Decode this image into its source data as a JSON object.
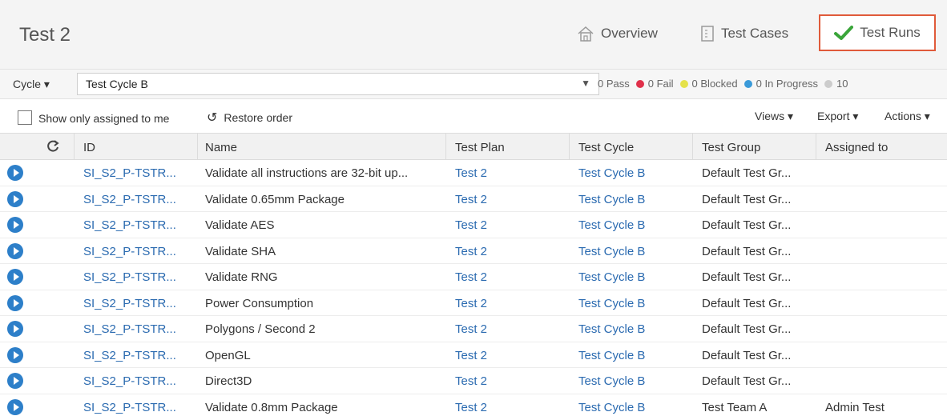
{
  "header": {
    "title": "Test 2",
    "nav": [
      {
        "label": "Overview",
        "icon": "home-icon"
      },
      {
        "label": "Test Cases",
        "icon": "document-icon"
      },
      {
        "label": "Test Runs",
        "icon": "checkmark-icon",
        "active": true
      }
    ]
  },
  "cycle_bar": {
    "label": "Cycle ▾",
    "selected": "Test Cycle B",
    "stats": [
      {
        "text": "0 Pass",
        "color": ""
      },
      {
        "text": "0 Fail",
        "color": "#e0304a"
      },
      {
        "text": "0 Blocked",
        "color": "#e5e24a"
      },
      {
        "text": "0 In Progress",
        "color": "#3a9ad9"
      },
      {
        "text": "10",
        "color": "#cccccc"
      }
    ]
  },
  "toolbar": {
    "show_assigned_label": "Show only assigned to me",
    "restore_label": "Restore order",
    "views_label": "Views ▾",
    "export_label": "Export ▾",
    "actions_label": "Actions ▾"
  },
  "table": {
    "columns": [
      "ID",
      "Name",
      "Test Plan",
      "Test Cycle",
      "Test Group",
      "Assigned to"
    ],
    "rows": [
      {
        "id": "SI_S2_P-TSTR...",
        "name": "Validate all instructions are 32-bit up...",
        "plan": "Test 2",
        "cycle": "Test Cycle B",
        "group": "Default Test Gr...",
        "assigned": ""
      },
      {
        "id": "SI_S2_P-TSTR...",
        "name": "Validate 0.65mm Package",
        "plan": "Test 2",
        "cycle": "Test Cycle B",
        "group": "Default Test Gr...",
        "assigned": ""
      },
      {
        "id": "SI_S2_P-TSTR...",
        "name": "Validate AES",
        "plan": "Test 2",
        "cycle": "Test Cycle B",
        "group": "Default Test Gr...",
        "assigned": ""
      },
      {
        "id": "SI_S2_P-TSTR...",
        "name": "Validate SHA",
        "plan": "Test 2",
        "cycle": "Test Cycle B",
        "group": "Default Test Gr...",
        "assigned": ""
      },
      {
        "id": "SI_S2_P-TSTR...",
        "name": "Validate RNG",
        "plan": "Test 2",
        "cycle": "Test Cycle B",
        "group": "Default Test Gr...",
        "assigned": ""
      },
      {
        "id": "SI_S2_P-TSTR...",
        "name": "Power Consumption",
        "plan": "Test 2",
        "cycle": "Test Cycle B",
        "group": "Default Test Gr...",
        "assigned": ""
      },
      {
        "id": "SI_S2_P-TSTR...",
        "name": "Polygons / Second 2",
        "plan": "Test 2",
        "cycle": "Test Cycle B",
        "group": "Default Test Gr...",
        "assigned": ""
      },
      {
        "id": "SI_S2_P-TSTR...",
        "name": "OpenGL",
        "plan": "Test 2",
        "cycle": "Test Cycle B",
        "group": "Default Test Gr...",
        "assigned": ""
      },
      {
        "id": "SI_S2_P-TSTR...",
        "name": "Direct3D",
        "plan": "Test 2",
        "cycle": "Test Cycle B",
        "group": "Default Test Gr...",
        "assigned": ""
      },
      {
        "id": "SI_S2_P-TSTR...",
        "name": "Validate 0.8mm Package",
        "plan": "Test 2",
        "cycle": "Test Cycle B",
        "group": "Test Team A",
        "assigned": "Admin Test"
      }
    ]
  }
}
